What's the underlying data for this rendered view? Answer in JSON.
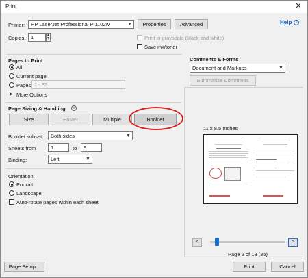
{
  "window": {
    "title": "Print",
    "close_glyph": "✕"
  },
  "help_link": "Help",
  "printer": {
    "label": "Printer:",
    "value": "HP LaserJet Professional P 1102w",
    "properties": "Properties",
    "advanced": "Advanced"
  },
  "copies": {
    "label": "Copies:",
    "value": "1"
  },
  "options": {
    "grayscale": "Print in grayscale (black and white)",
    "save_ink": "Save ink/toner"
  },
  "pages_to_print": {
    "title": "Pages to Print",
    "all": "All",
    "current": "Current page",
    "pages": "Pages",
    "pages_value": "1 - 35",
    "more": "More Options"
  },
  "comments": {
    "title": "Comments & Forms",
    "value": "Document and Markups",
    "summarize": "Summarize Comments"
  },
  "sizing": {
    "title": "Page Sizing & Handling",
    "info_glyph": "i",
    "tabs": [
      "Size",
      "Poster",
      "Multiple",
      "Booklet"
    ],
    "subset_label": "Booklet subset:",
    "subset_value": "Both sides",
    "sheets_label": "Sheets from",
    "sheets_from": "1",
    "sheets_to_label": "to",
    "sheets_to": "9",
    "binding_label": "Binding:",
    "binding_value": "Left"
  },
  "orientation": {
    "title": "Orientation:",
    "portrait": "Portrait",
    "landscape": "Landscape",
    "autorotate": "Auto-rotate pages within each sheet"
  },
  "preview": {
    "size_label": "11 x 8.5 Inches",
    "page_label": "Page 2 of 18 (35)",
    "prev_glyph": "<",
    "next_glyph": ">",
    "page_position_fraction": 0.06
  },
  "footer": {
    "page_setup": "Page Setup...",
    "print": "Print",
    "cancel": "Cancel"
  },
  "colors": {
    "accent": "#1a6fd1",
    "annotation_ring": "#d71e1e",
    "link": "#1a5fb4"
  }
}
